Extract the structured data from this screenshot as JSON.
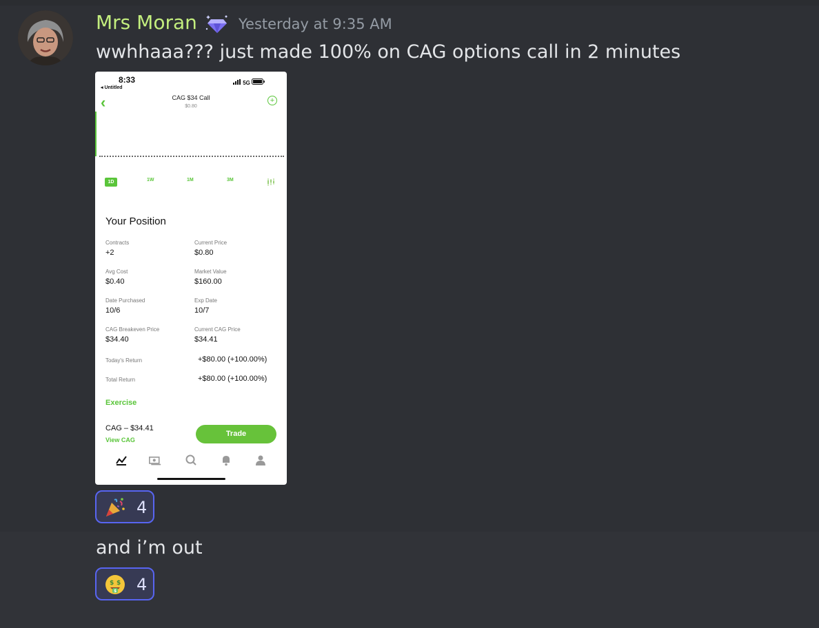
{
  "message": {
    "username": "Mrs Moran",
    "badge_icon": "diamond-sparkle-icon",
    "timestamp": "Yesterday at 9:35 AM",
    "text": "wwhhaaa??? just made 100% on CAG options call in 2 minutes",
    "reaction": {
      "emoji": "party-popper-emoji",
      "count": "4"
    }
  },
  "followup": {
    "text": "and i’m out",
    "reaction": {
      "emoji": "money-mouth-face-emoji",
      "count": "4"
    }
  },
  "attachment": {
    "status": {
      "time": "8:33",
      "back_label": "◂ Untitled",
      "signal": "5G"
    },
    "header": {
      "title": "CAG $34 Call",
      "price": "$0.80"
    },
    "ranges": [
      "1D",
      "1W",
      "1M",
      "3M"
    ],
    "active_range": "1D",
    "position": {
      "title": "Your Position",
      "contracts_label": "Contracts",
      "contracts_value": "+2",
      "current_price_label": "Current Price",
      "current_price_value": "$0.80",
      "avg_cost_label": "Avg Cost",
      "avg_cost_value": "$0.40",
      "market_value_label": "Market Value",
      "market_value_value": "$160.00",
      "date_purchased_label": "Date Purchased",
      "date_purchased_value": "10/6",
      "exp_date_label": "Exp Date",
      "exp_date_value": "10/7",
      "breakeven_label": "CAG Breakeven Price",
      "breakeven_value": "$34.40",
      "current_cag_label": "Current CAG Price",
      "current_cag_value": "$34.41",
      "todays_return_label": "Today's Return",
      "todays_return_value": "+$80.00 (+100.00%)",
      "total_return_label": "Total Return",
      "total_return_value": "+$80.00 (+100.00%)"
    },
    "exercise_label": "Exercise",
    "footer": {
      "cag_price": "CAG – $34.41",
      "view_label": "View CAG",
      "trade_label": "Trade"
    },
    "colors": {
      "accent": "#5ac53a",
      "trade_button": "#67c23a"
    }
  },
  "colors": {
    "username": "#c3ee7e",
    "timestamp": "#949ba4",
    "reaction_border": "#5865f2",
    "background": "#313338"
  }
}
